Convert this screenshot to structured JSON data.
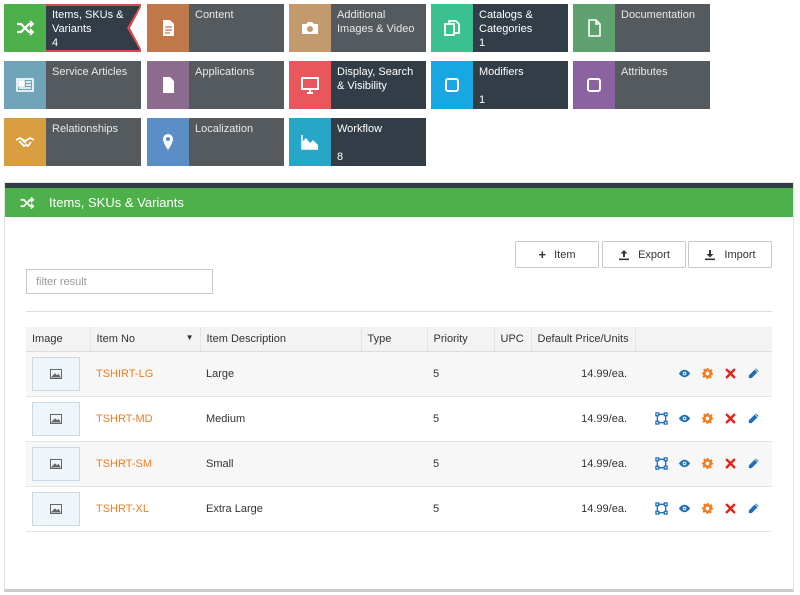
{
  "tiles": [
    {
      "label": "Items, SKUs & Variants",
      "count": "4",
      "color": "#4db04a",
      "icon": "shuffle-icon",
      "active": true
    },
    {
      "label": "Content",
      "count": "",
      "color": "#c0784a",
      "icon": "document-icon"
    },
    {
      "label": "Additional Images & Video",
      "count": "",
      "color": "#c29a6e",
      "icon": "camera-icon"
    },
    {
      "label": "Catalogs & Categories",
      "count": "1",
      "color": "#3cc08f",
      "icon": "copy-icon"
    },
    {
      "label": "Documentation",
      "count": "",
      "color": "#5ea06e",
      "icon": "file-icon"
    },
    {
      "label": "Service Articles",
      "count": "",
      "color": "#6fa3b8",
      "icon": "newspaper-icon"
    },
    {
      "label": "Applications",
      "count": "",
      "color": "#8c6b8e",
      "icon": "page-icon"
    },
    {
      "label": "Display, Search & Visibility",
      "count": "",
      "color": "#e9575c",
      "icon": "monitor-icon"
    },
    {
      "label": "Modifiers",
      "count": "1",
      "color": "#19a7e2",
      "icon": "square-icon"
    },
    {
      "label": "Attributes",
      "count": "",
      "color": "#8b63a1",
      "icon": "square-outline-icon"
    },
    {
      "label": "Relationships",
      "count": "",
      "color": "#d79d3e",
      "icon": "handshake-icon"
    },
    {
      "label": "Localization",
      "count": "",
      "color": "#5b8ec7",
      "icon": "map-pin-icon"
    },
    {
      "label": "Workflow",
      "count": "8",
      "color": "#28a6c7",
      "icon": "area-chart-icon"
    }
  ],
  "panel": {
    "title": "Items, SKUs & Variants",
    "buttons": {
      "item": "Item",
      "export": "Export",
      "import": "Import"
    },
    "filter_placeholder": "filter result"
  },
  "table": {
    "columns": [
      "Image",
      "Item No",
      "Item Description",
      "Type",
      "Priority",
      "UPC",
      "Default Price/Units",
      ""
    ],
    "rows": [
      {
        "item_no": "TSHIRT-LG",
        "description": "Large",
        "type": "",
        "priority": "5",
        "upc": "",
        "price": "14.99/ea.",
        "has_variant_icon": false
      },
      {
        "item_no": "TSHRT-MD",
        "description": "Medium",
        "type": "",
        "priority": "5",
        "upc": "",
        "price": "14.99/ea.",
        "has_variant_icon": true
      },
      {
        "item_no": "TSHRT-SM",
        "description": "Small",
        "type": "",
        "priority": "5",
        "upc": "",
        "price": "14.99/ea.",
        "has_variant_icon": true
      },
      {
        "item_no": "TSHRT-XL",
        "description": "Extra Large",
        "type": "",
        "priority": "5",
        "upc": "",
        "price": "14.99/ea.",
        "has_variant_icon": true
      }
    ]
  },
  "colors": {
    "accent_green": "#4db04a",
    "link_orange": "#ef7d22",
    "dark_tile": "#323d48",
    "gray_tile": "#555a5e"
  }
}
